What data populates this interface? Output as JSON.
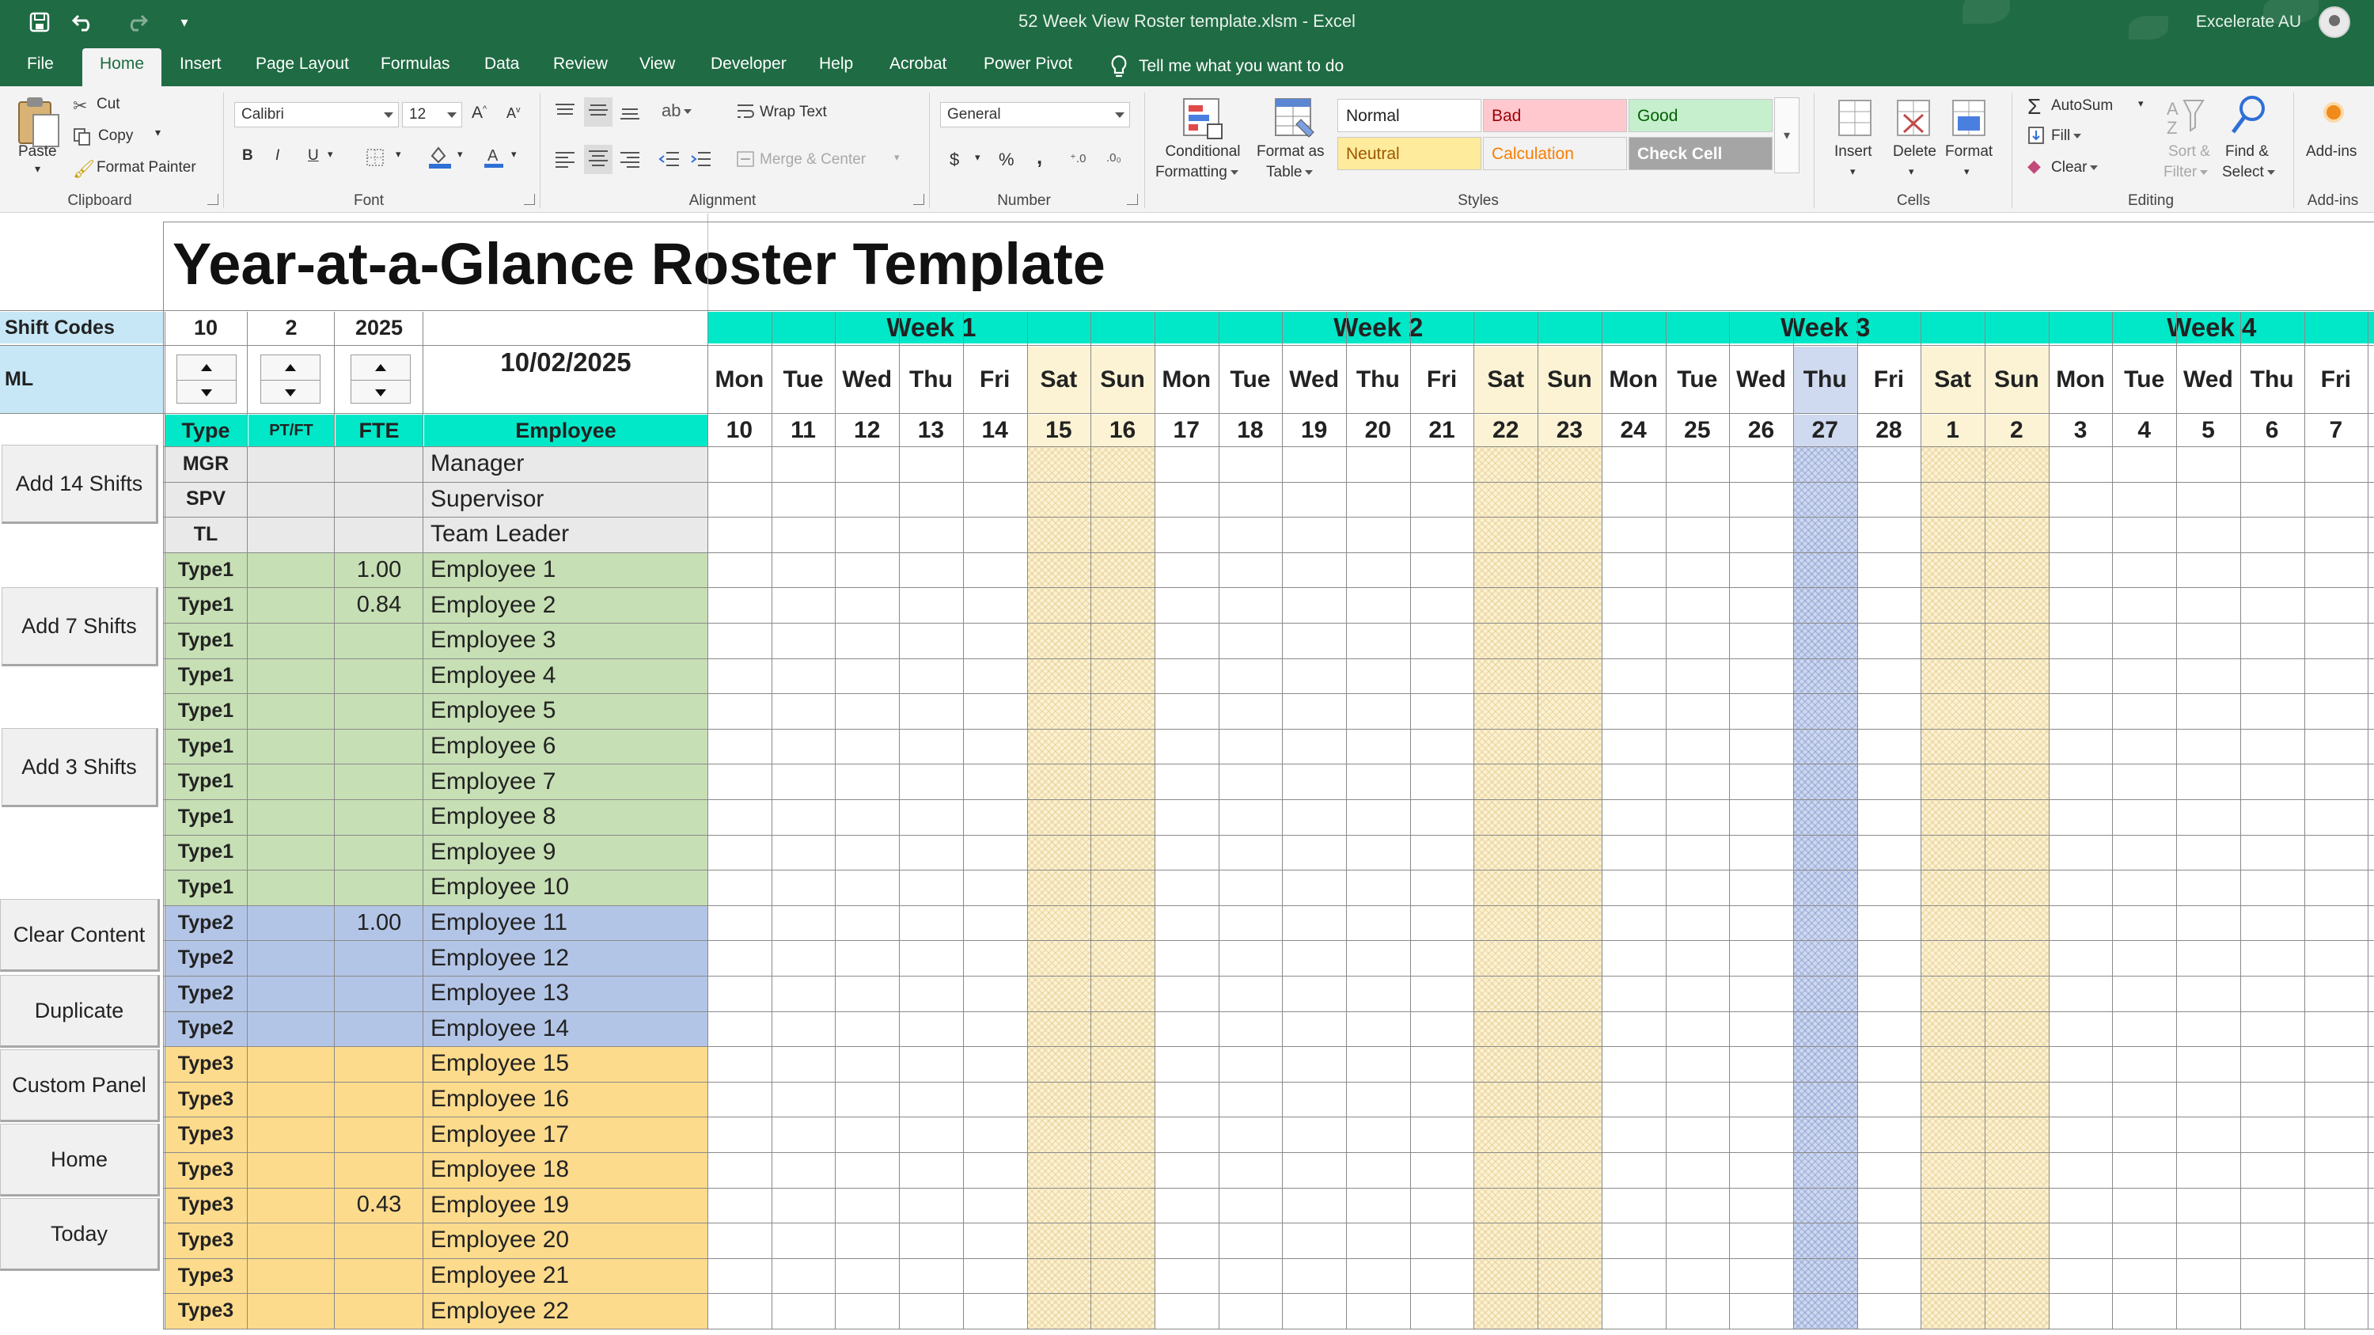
{
  "window": {
    "title": "52 Week View Roster template.xlsm  -  Excel",
    "user": "Excelerate AU",
    "quick_access": [
      "save-icon",
      "undo-icon",
      "redo-icon",
      "customize-icon"
    ]
  },
  "menu": {
    "tabs": [
      "File",
      "Home",
      "Insert",
      "Page Layout",
      "Formulas",
      "Data",
      "Review",
      "View",
      "Developer",
      "Help",
      "Acrobat",
      "Power Pivot"
    ],
    "active": "Home",
    "tell_me": "Tell me what you want to do"
  },
  "ribbon": {
    "clipboard": {
      "label": "Clipboard",
      "paste": "Paste",
      "cut": "Cut",
      "copy": "Copy",
      "format_painter": "Format Painter"
    },
    "font": {
      "label": "Font",
      "family": "Calibri",
      "size": "12",
      "bold": "B",
      "italic": "I",
      "underline": "U"
    },
    "alignment": {
      "label": "Alignment",
      "wrap_text": "Wrap Text",
      "merge_center": "Merge & Center"
    },
    "number": {
      "label": "Number",
      "format": "General",
      "currency": "$",
      "percent": "%",
      "comma": ","
    },
    "styles": {
      "label": "Styles",
      "conditional_formatting": [
        "Conditional",
        "Formatting"
      ],
      "format_as_table": [
        "Format as",
        "Table"
      ],
      "cells": [
        {
          "name": "Normal",
          "bg": "#ffffff",
          "fg": "#222222"
        },
        {
          "name": "Bad",
          "bg": "#ffc7ce",
          "fg": "#9c0006"
        },
        {
          "name": "Good",
          "bg": "#c6efce",
          "fg": "#006100"
        },
        {
          "name": "Neutral",
          "bg": "#ffeb9c",
          "fg": "#9c5700"
        },
        {
          "name": "Calculation",
          "bg": "#f2f2f2",
          "fg": "#fa7d00"
        },
        {
          "name": "Check Cell",
          "bg": "#a5a5a5",
          "fg": "#ffffff"
        }
      ]
    },
    "cells": {
      "label": "Cells",
      "insert": "Insert",
      "delete": "Delete",
      "format": "Format"
    },
    "editing": {
      "label": "Editing",
      "autosum": "AutoSum",
      "fill": "Fill",
      "clear": "Clear",
      "sort_filter": [
        "Sort &",
        "Filter"
      ],
      "find_select": [
        "Find &",
        "Select"
      ]
    },
    "addins": {
      "label": "Add-ins",
      "addins": "Add-ins"
    }
  },
  "sheet": {
    "title": "Year-at-a-Glance Roster Template",
    "shift_codes_label": "Shift Codes",
    "ml_label": "ML",
    "spinners": {
      "day": "10",
      "month": "2",
      "year": "2025"
    },
    "date": "10/02/2025",
    "headers": {
      "type": "Type",
      "ptft": "PT/FT",
      "fte": "FTE",
      "employee": "Employee"
    },
    "buttons": [
      "Add 14 Shifts",
      "Add 7 Shifts",
      "Add 3 Shifts",
      "Clear Content",
      "Duplicate",
      "Custom Panel",
      "Home",
      "Today"
    ],
    "weeks": [
      "Week 1",
      "Week 2",
      "Week 3",
      "Week 4"
    ],
    "days": [
      "Mon",
      "Tue",
      "Wed",
      "Thu",
      "Fri",
      "Sat",
      "Sun",
      "Mon",
      "Tue",
      "Wed",
      "Thu",
      "Fri",
      "Sat",
      "Sun",
      "Mon",
      "Tue",
      "Wed",
      "Thu",
      "Fri",
      "Sat",
      "Sun",
      "Mon",
      "Tue",
      "Wed",
      "Thu",
      "Fri"
    ],
    "dates": [
      "10",
      "11",
      "12",
      "13",
      "14",
      "15",
      "16",
      "17",
      "18",
      "19",
      "20",
      "21",
      "22",
      "23",
      "24",
      "25",
      "26",
      "27",
      "28",
      "1",
      "2",
      "3",
      "4",
      "5",
      "6",
      "7"
    ],
    "weekend_indices": [
      5,
      6,
      12,
      13,
      19,
      20
    ],
    "today_index": 17,
    "colors": {
      "header_teal": "#00e8c8",
      "shift_codes_bg": "#c7e7f7",
      "mgr_bg": "#e9e9e9",
      "type1_bg": "#c6dfb4",
      "type2_bg": "#b3c5e7",
      "type3_bg": "#fddb8c",
      "weekend_bg": "#fcf3d4",
      "today_bg": "#cfd9ef"
    },
    "rows": [
      {
        "type": "MGR",
        "ptft": "",
        "fte": "",
        "employee": "Manager",
        "group": "mgr"
      },
      {
        "type": "SPV",
        "ptft": "",
        "fte": "",
        "employee": "Supervisor",
        "group": "mgr"
      },
      {
        "type": "TL",
        "ptft": "",
        "fte": "",
        "employee": "Team Leader",
        "group": "mgr"
      },
      {
        "type": "Type1",
        "ptft": "",
        "fte": "1.00",
        "employee": "Employee 1",
        "group": "type1"
      },
      {
        "type": "Type1",
        "ptft": "",
        "fte": "0.84",
        "employee": "Employee 2",
        "group": "type1"
      },
      {
        "type": "Type1",
        "ptft": "",
        "fte": "",
        "employee": "Employee 3",
        "group": "type1"
      },
      {
        "type": "Type1",
        "ptft": "",
        "fte": "",
        "employee": "Employee 4",
        "group": "type1"
      },
      {
        "type": "Type1",
        "ptft": "",
        "fte": "",
        "employee": "Employee 5",
        "group": "type1"
      },
      {
        "type": "Type1",
        "ptft": "",
        "fte": "",
        "employee": "Employee 6",
        "group": "type1"
      },
      {
        "type": "Type1",
        "ptft": "",
        "fte": "",
        "employee": "Employee 7",
        "group": "type1"
      },
      {
        "type": "Type1",
        "ptft": "",
        "fte": "",
        "employee": "Employee 8",
        "group": "type1"
      },
      {
        "type": "Type1",
        "ptft": "",
        "fte": "",
        "employee": "Employee 9",
        "group": "type1"
      },
      {
        "type": "Type1",
        "ptft": "",
        "fte": "",
        "employee": "Employee 10",
        "group": "type1"
      },
      {
        "type": "Type2",
        "ptft": "",
        "fte": "1.00",
        "employee": "Employee 11",
        "group": "type2"
      },
      {
        "type": "Type2",
        "ptft": "",
        "fte": "",
        "employee": "Employee 12",
        "group": "type2"
      },
      {
        "type": "Type2",
        "ptft": "",
        "fte": "",
        "employee": "Employee 13",
        "group": "type2"
      },
      {
        "type": "Type2",
        "ptft": "",
        "fte": "",
        "employee": "Employee 14",
        "group": "type2"
      },
      {
        "type": "Type3",
        "ptft": "",
        "fte": "",
        "employee": "Employee 15",
        "group": "type3"
      },
      {
        "type": "Type3",
        "ptft": "",
        "fte": "",
        "employee": "Employee 16",
        "group": "type3"
      },
      {
        "type": "Type3",
        "ptft": "",
        "fte": "",
        "employee": "Employee 17",
        "group": "type3"
      },
      {
        "type": "Type3",
        "ptft": "",
        "fte": "",
        "employee": "Employee 18",
        "group": "type3"
      },
      {
        "type": "Type3",
        "ptft": "",
        "fte": "0.43",
        "employee": "Employee 19",
        "group": "type3"
      },
      {
        "type": "Type3",
        "ptft": "",
        "fte": "",
        "employee": "Employee 20",
        "group": "type3"
      },
      {
        "type": "Type3",
        "ptft": "",
        "fte": "",
        "employee": "Employee 21",
        "group": "type3"
      },
      {
        "type": "Type3",
        "ptft": "",
        "fte": "",
        "employee": "Employee 22",
        "group": "type3"
      }
    ]
  }
}
